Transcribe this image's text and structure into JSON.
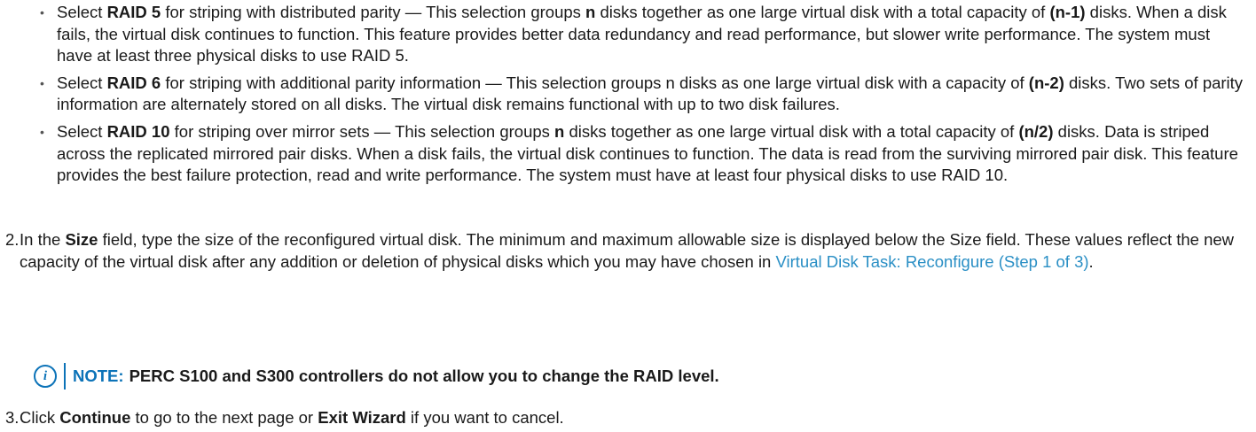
{
  "bullets": [
    {
      "pre": "Select ",
      "bold1": "RAID 5",
      "mid1": " for striping with distributed parity — This selection groups ",
      "bold2": "n",
      "mid2": " disks together as one large virtual disk with a total capacity of ",
      "bold3": "(n-1)",
      "post": " disks. When a disk fails, the virtual disk continues to function. This feature provides better data redundancy and read performance, but slower write performance. The system must have at least three physical disks to use RAID 5."
    },
    {
      "pre": "Select ",
      "bold1": "RAID 6",
      "mid1": " for striping with additional parity information — This selection groups n disks as one large virtual disk with a capacity of ",
      "bold2": "(n-2)",
      "post": " disks. Two sets of parity information are alternately stored on all disks. The virtual disk remains functional with up to two disk failures."
    },
    {
      "pre": "Select ",
      "bold1": "RAID 10",
      "mid1": " for striping over mirror sets — This selection groups ",
      "bold2": "n",
      "mid2": " disks together as one large virtual disk with a total capacity of ",
      "bold3": "(n/2)",
      "post": " disks. Data is striped across the replicated mirrored pair disks. When a disk fails, the virtual disk continues to function. The data is read from the surviving mirrored pair disk. This feature provides the best failure protection, read and write performance. The system must have at least four physical disks to use RAID 10."
    }
  ],
  "bullet_glyph": "•",
  "step2": {
    "number": "2.",
    "pre": "In the ",
    "bold": "Size",
    "mid": " field, type the size of the reconfigured virtual disk. The minimum and maximum allowable size is displayed below the Size field. These values reflect the new capacity of the virtual disk after any addition or deletion of physical disks which you may have chosen in ",
    "link": "Virtual Disk Task: Reconfigure (Step 1 of 3)",
    "post": "."
  },
  "note": {
    "icon": "i",
    "label": "NOTE:",
    "text": "PERC S100 and S300 controllers do not allow you to change the RAID level."
  },
  "step3": {
    "number": "3.",
    "pre": "Click ",
    "bold1": "Continue",
    "mid": " to go to the next page or ",
    "bold2": "Exit Wizard",
    "post": " if you want to cancel."
  },
  "colors": {
    "link": "#2a8fc5",
    "note_accent": "#0c73b8",
    "text": "#1a1a1a"
  }
}
